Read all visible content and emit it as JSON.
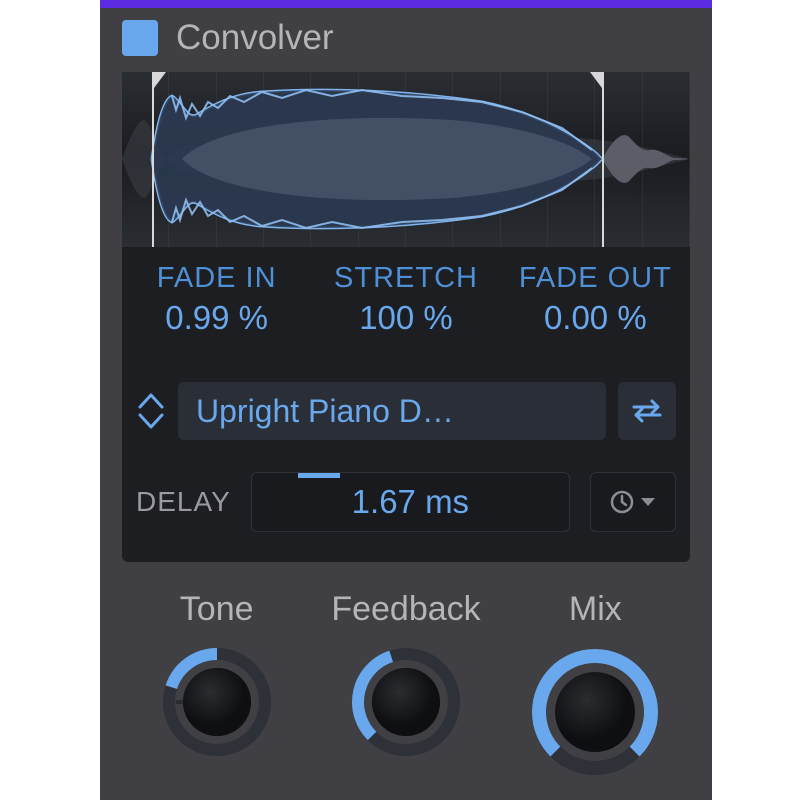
{
  "header": {
    "title": "Convolver"
  },
  "fade": {
    "in_label": "FADE IN",
    "in_value": "0.99 %",
    "stretch_label": "STRETCH",
    "stretch_value": "100 %",
    "out_label": "FADE OUT",
    "out_value": "0.00 %"
  },
  "preset": {
    "name": "Upright Piano D…"
  },
  "delay": {
    "label": "DELAY",
    "value": "1.67 ms"
  },
  "knobs": {
    "tone": {
      "label": "Tone",
      "percent": 50
    },
    "feedback": {
      "label": "Feedback",
      "percent": 40
    },
    "mix": {
      "label": "Mix",
      "percent": 100
    }
  },
  "colors": {
    "accent": "#6aa8ee",
    "accent_bar": "#5a2be0",
    "panel": "#3f3f44",
    "inner": "#1c1e22"
  }
}
